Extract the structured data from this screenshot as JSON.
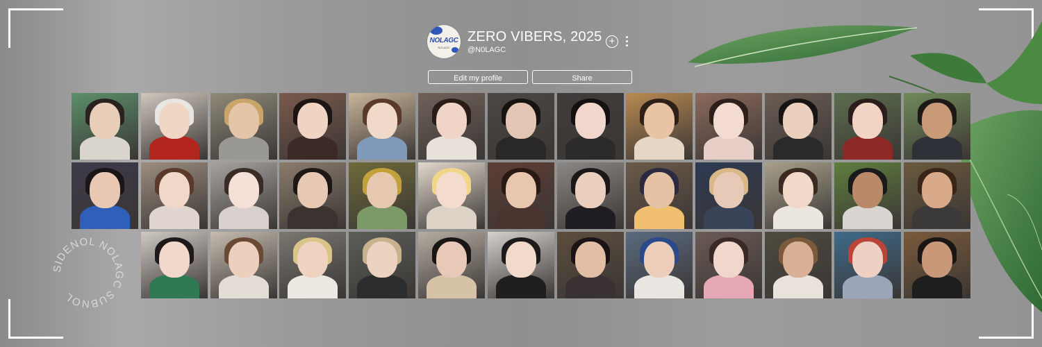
{
  "profile": {
    "title": "ZERO VIBERS, 2025",
    "handle": "@N0LAGC",
    "avatar_logo": "NOLAGC",
    "avatar_sub": "NOLAGC",
    "edit_label": "Edit my profile",
    "share_label": "Share"
  },
  "icons": {
    "add": "plus-circle-icon",
    "more": "vertical-ellipsis-icon"
  },
  "circle_text": "SIDENOL NOLAGC SUBNOL",
  "colors": {
    "accent": "#ffffff",
    "background": "#9a9a9a",
    "leaf": "#4f8a45"
  },
  "photos": [
    {
      "bg": "#5b8f6a",
      "hair": "#2a2220",
      "skin": "#e8cdb9",
      "body": "#d9d4cc"
    },
    {
      "bg": "#cfc6bd",
      "hair": "#e8e6e2",
      "skin": "#efd6c5",
      "body": "#b3261e"
    },
    {
      "bg": "#8f8a7a",
      "hair": "#c9a56a",
      "skin": "#e5c5a8",
      "body": "#9a9895"
    },
    {
      "bg": "#7a5a4c",
      "hair": "#1c1514",
      "skin": "#efd3c3",
      "body": "#3d2a26"
    },
    {
      "bg": "#c8b49a",
      "hair": "#5a3a28",
      "skin": "#f0d9c8",
      "body": "#7e9ab8"
    },
    {
      "bg": "#6f625a",
      "hair": "#2a1d18",
      "skin": "#f0d5c6",
      "body": "#e7e1da"
    },
    {
      "bg": "#4a4845",
      "hair": "#161311",
      "skin": "#e2c6b3",
      "body": "#2a2826"
    },
    {
      "bg": "#3f3c3a",
      "hair": "#151111",
      "skin": "#f1d7cb",
      "body": "#2c2a2a"
    },
    {
      "bg": "#b98a52",
      "hair": "#2c2018",
      "skin": "#e8c3a4",
      "body": "#e5d6c6"
    },
    {
      "bg": "#8c6a5c",
      "hair": "#2e1f1a",
      "skin": "#f3dbd1",
      "body": "#e7cfc8"
    },
    {
      "bg": "#6b5d54",
      "hair": "#181413",
      "skin": "#ecd0be",
      "body": "#2a2a2a"
    },
    {
      "bg": "#5c6e4e",
      "hair": "#2a1d1b",
      "skin": "#f1d4c4",
      "body": "#8e2a26"
    },
    {
      "bg": "#718a5a",
      "hair": "#1d1917",
      "skin": "#c89a78",
      "body": "#2e3238"
    },
    {
      "bg": "#3d3a4a",
      "hair": "#1a1516",
      "skin": "#e8c7b3",
      "body": "#2f5fb8"
    },
    {
      "bg": "#9c8d80",
      "hair": "#5a3a2a",
      "skin": "#f0d8c9",
      "body": "#e0d6cf"
    },
    {
      "bg": "#a7a3a0",
      "hair": "#3a2b27",
      "skin": "#f4e0d6",
      "body": "#d8d0cc"
    },
    {
      "bg": "#8a7c6c",
      "hair": "#1d1816",
      "skin": "#e7c8b2",
      "body": "#3a3330"
    },
    {
      "bg": "#6e6a3a",
      "hair": "#c2a03a",
      "skin": "#e6c8b0",
      "body": "#7a9a68"
    },
    {
      "bg": "#e2d8cc",
      "hair": "#f1d68a",
      "skin": "#f3dccb",
      "body": "#ddd2c6"
    },
    {
      "bg": "#5e3e34",
      "hair": "#2a1a16",
      "skin": "#e9c6ae",
      "body": "#4a3430"
    },
    {
      "bg": "#8a8784",
      "hair": "#1c1818",
      "skin": "#ecd0bf",
      "body": "#1e1e22"
    },
    {
      "bg": "#6b5a48",
      "hair": "#2b2a40",
      "skin": "#e5c2a6",
      "body": "#f0c070"
    },
    {
      "bg": "#2d3a52",
      "hair": "#d8b888",
      "skin": "#e6c9b6",
      "body": "#3a4458"
    },
    {
      "bg": "#a8a08a",
      "hair": "#3a2a22",
      "skin": "#f1d8c8",
      "body": "#ece6e0"
    },
    {
      "bg": "#5f7e3e",
      "hair": "#1a1a1a",
      "skin": "#b88a6a",
      "body": "#d8d4cf"
    },
    {
      "bg": "#6a5a3e",
      "hair": "#3a2618",
      "skin": "#d9aa8a",
      "body": "#3b3a38"
    },
    {
      "bg": "#cfc9c3",
      "hair": "#1e1a19",
      "skin": "#f0d8ca",
      "body": "#2f7a54"
    },
    {
      "bg": "#c6bcb0",
      "hair": "#6a4a36",
      "skin": "#edcfbd",
      "body": "#e3ddd5"
    },
    {
      "bg": "#7a7670",
      "hair": "#d9c48a",
      "skin": "#efd3c0",
      "body": "#ece8e2"
    },
    {
      "bg": "#5a5e58",
      "hair": "#c8b28e",
      "skin": "#ecd2c0",
      "body": "#2c2d2e"
    },
    {
      "bg": "#b6aca2",
      "hair": "#1a1616",
      "skin": "#e8c9b8",
      "body": "#d6c2a6"
    },
    {
      "bg": "#d4d0cc",
      "hair": "#1c1a1a",
      "skin": "#f1d9cb",
      "body": "#1f1f1f"
    },
    {
      "bg": "#5c4e3e",
      "hair": "#1c1414",
      "skin": "#e2bfa4",
      "body": "#3a3232"
    },
    {
      "bg": "#5a6a80",
      "hair": "#2a4a8a",
      "skin": "#ebcdb9",
      "body": "#e9e6e2"
    },
    {
      "bg": "#6a5a56",
      "hair": "#3a2a26",
      "skin": "#f1d6cb",
      "body": "#e7a8b6"
    },
    {
      "bg": "#4e4a3e",
      "hair": "#7a5a3a",
      "skin": "#d8b096",
      "body": "#e8e2da"
    },
    {
      "bg": "#3e6a8a",
      "hair": "#b8443a",
      "skin": "#efd1c4",
      "body": "#9aa6b8"
    },
    {
      "bg": "#7a5a3a",
      "hair": "#1a1616",
      "skin": "#c89878",
      "body": "#1e1e1e"
    }
  ]
}
